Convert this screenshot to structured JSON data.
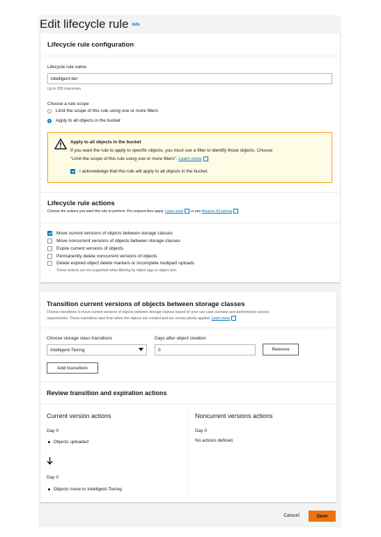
{
  "page": {
    "title": "Edit lifecycle rule",
    "info_label": "Info"
  },
  "config": {
    "section_title": "Lifecycle rule configuration",
    "name_label": "Lifecycle rule name",
    "name_value": "intelligent-tier",
    "name_hint": "Up to 255 characters",
    "scope_label": "Choose a rule scope",
    "scope_options": [
      {
        "label": "Limit the scope of this rule using one or more filters",
        "selected": false
      },
      {
        "label": "Apply to all objects in the bucket",
        "selected": true
      }
    ],
    "warning": {
      "title": "Apply to all objects in the bucket",
      "body_line1": "If you want the rule to apply to specific objects, you must use a filter to identify those objects. Choose",
      "body_line2": "\"Limit the scope of this rule using one or more filters\".",
      "learn_more": "Learn more",
      "ack_label": "I acknowledge that this rule will apply to all objects in the bucket.",
      "ack_checked": true
    }
  },
  "actions": {
    "section_title": "Lifecycle rule actions",
    "description": "Choose the actions you want this rule to perform. Per-request fees apply.",
    "learn_more": "Learn more",
    "or_see": "or see",
    "pricing_link": "Amazon S3 pricing",
    "items": [
      {
        "label": "Move current versions of objects between storage classes",
        "checked": true
      },
      {
        "label": "Move noncurrent versions of objects between storage classes",
        "checked": false
      },
      {
        "label": "Expire current versions of objects",
        "checked": false
      },
      {
        "label": "Permanently delete noncurrent versions of objects",
        "checked": false
      },
      {
        "label": "Delete expired object delete markers or incomplete multipart uploads",
        "checked": false
      }
    ],
    "note": "These actions are not supported when filtering by object tags or object size."
  },
  "transition": {
    "section_title": "Transition current versions of objects between storage classes",
    "description_line1": "Choose transitions to move current versions of objects between storage classes based on your use case scenario and performance access",
    "description_line2": "requirements. These transitions start from when the objects are created and are consecutively applied.",
    "learn_more": "Learn more",
    "storage_label": "Choose storage class transitions",
    "storage_value": "Intelligent-Tiering",
    "days_label": "Days after object creation",
    "days_value": "0",
    "remove_label": "Remove",
    "add_label": "Add transition"
  },
  "review": {
    "section_title": "Review transition and expiration actions",
    "current": {
      "title": "Current version actions",
      "day0": "Day 0",
      "bullet0": "Objects uploaded",
      "day1": "Day 0",
      "bullet1": "Objects move to Intelligent-Tiering"
    },
    "noncurrent": {
      "title": "Noncurrent versions actions",
      "day0": "Day 0",
      "text": "No actions defined."
    }
  },
  "footer": {
    "cancel_label": "Cancel",
    "save_label": "Save",
    "save_color": "#ec7211"
  }
}
